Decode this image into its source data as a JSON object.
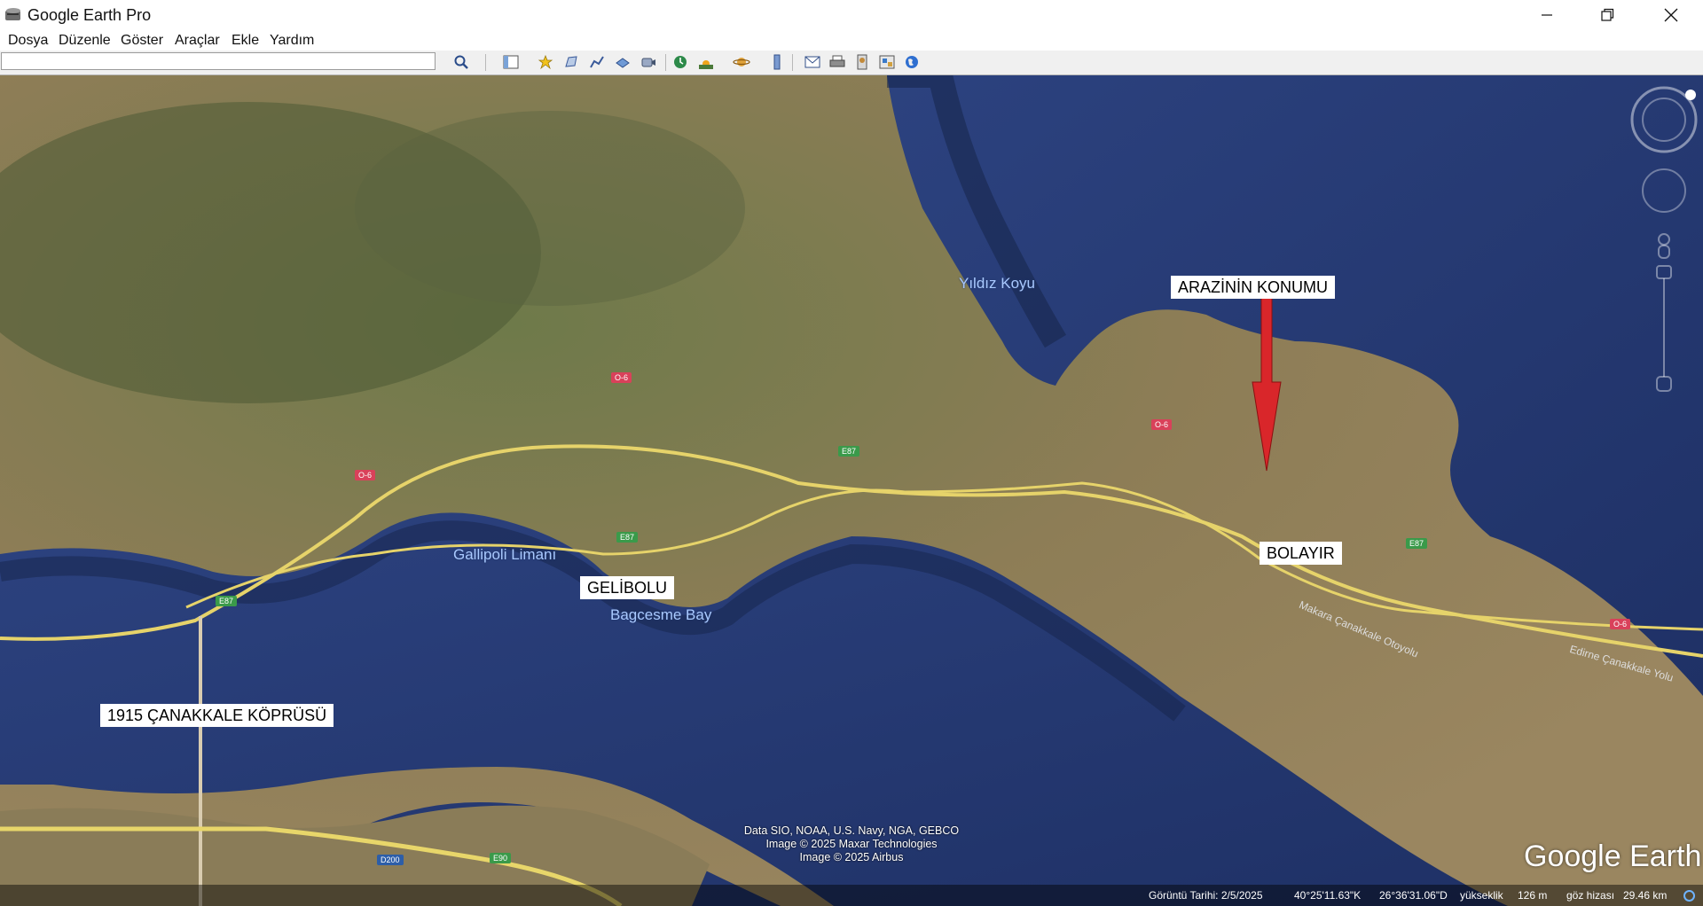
{
  "window": {
    "title": "Google Earth Pro",
    "icons": [
      "app-icon",
      "minimize-icon",
      "restore-icon",
      "close-icon"
    ]
  },
  "menu": [
    "Dosya",
    "Düzenle",
    "Göster",
    "Araçlar",
    "Ekle",
    "Yardım"
  ],
  "search": {
    "value": "",
    "placeholder": ""
  },
  "toolbar_icons": [
    "search-icon",
    "sidebar-toggle-icon",
    "placemark-icon",
    "polygon-icon",
    "path-icon",
    "image-overlay-icon",
    "record-tour-icon",
    "historical-imagery-icon",
    "sunlight-icon",
    "planets-icon",
    "ruler-icon",
    "email-icon",
    "print-icon",
    "save-image-icon",
    "view-in-maps-icon",
    "earth-icon"
  ],
  "map": {
    "annotations": {
      "arazi": "ARAZİNİN KONUMU",
      "bolayir": "BOLAYIR",
      "gelibolu": "GELİBOLU",
      "kopru": "1915 ÇANAKKALE KÖPRÜSÜ"
    },
    "places": {
      "yildiz": "Yıldız Koyu",
      "gallipoli": "Gallipoli Limanı",
      "bagcesme": "Bagcesme Bay",
      "road_small": "Makara Çanakkale Otoyolu",
      "road_east": "Edirne Çanakkale Yolu"
    },
    "road_shields": {
      "o6": "O-6",
      "e87": "E87",
      "d200": "D200",
      "e90": "E90"
    },
    "attribution": [
      "Data SIO, NOAA, U.S. Navy, NGA, GEBCO",
      "Image © 2025 Maxar Technologies",
      "Image © 2025 Airbus"
    ],
    "logo": "Google Earth",
    "colors": {
      "sea": "#2b3f7a",
      "land": "#8d7d56",
      "road": "#e6d36a",
      "pointer": "#d9262a"
    }
  },
  "status": {
    "date": "Görüntü Tarihi: 2/5/2025",
    "lat": "40°25'11.63\"K",
    "lon": "26°36'31.06\"D",
    "elev_label": "yükseklik",
    "elev_value": "126 m",
    "eye_label": "göz hizası",
    "eye_value": "29.46 km"
  }
}
